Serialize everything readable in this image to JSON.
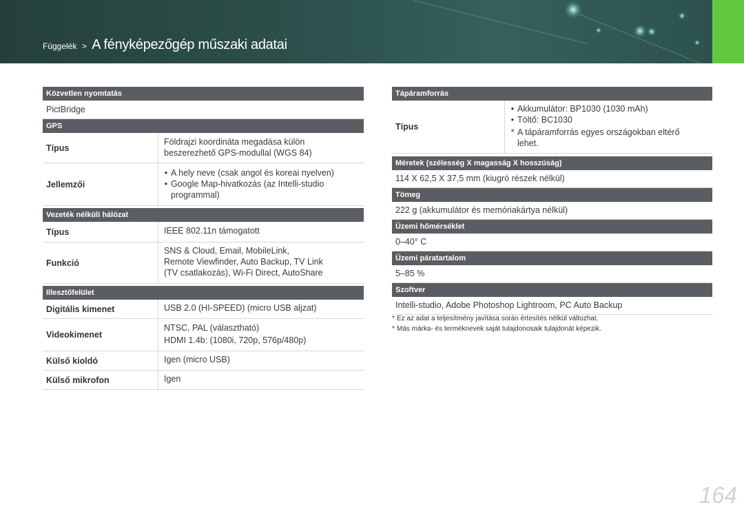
{
  "header": {
    "breadcrumb_prefix": "Függelék",
    "breadcrumb_sep": ">",
    "title": "A fényképezőgép műszaki adatai"
  },
  "left": {
    "direct_print": {
      "title": "Közvetlen nyomtatás",
      "value": "PictBridge"
    },
    "gps": {
      "title": "GPS",
      "type_label": "Típus",
      "type_value": [
        "Földrajzi koordináta megadása külön",
        "beszerezhető GPS-modullal (WGS 84)"
      ],
      "features_label": "Jellemzői",
      "features": [
        [
          "A hely neve (csak angol és koreai nyelven)"
        ],
        [
          "Google Map-hivatkozás (az Intelli-studio",
          "programmal)"
        ]
      ]
    },
    "wireless": {
      "title": "Vezeték nélküli hálózat",
      "type_label": "Típus",
      "type_value": "IEEE 802.11n támogatott",
      "function_label": "Funkció",
      "function_value": [
        "SNS & Cloud, Email, MobileLink,",
        "Remote Viewfinder, Auto Backup, TV Link",
        "(TV csatlakozás), Wi-Fi Direct, AutoShare"
      ]
    },
    "interface": {
      "title": "Illesztőfelület",
      "rows": [
        {
          "label": "Digitális kimenet",
          "value": [
            "USB 2.0 (HI-SPEED) (micro USB aljzat)"
          ]
        },
        {
          "label": "Videokimenet",
          "value": [
            "NTSC, PAL (választható)",
            "HDMI 1.4b: (1080i, 720p, 576p/480p)"
          ]
        },
        {
          "label": "Külső kioldó",
          "value": [
            "Igen (micro USB)"
          ]
        },
        {
          "label": "Külső mikrofon",
          "value": [
            "Igen"
          ]
        }
      ]
    }
  },
  "right": {
    "power": {
      "title": "Tápáramforrás",
      "type_label": "Típus",
      "items": [
        {
          "marker": "•",
          "lines": [
            "Akkumulátor: BP1030 (1030 mAh)"
          ]
        },
        {
          "marker": "•",
          "lines": [
            "Töltő: BC1030"
          ]
        },
        {
          "marker": "*",
          "lines": [
            "A tápáramforrás egyes országokban eltérő",
            "lehet."
          ]
        }
      ]
    },
    "dimensions": {
      "title": "Méretek (szélesség X magasság X hosszúság)",
      "value": "114 X 62,5 X 37,5 mm (kiugró részek nélkül)"
    },
    "weight": {
      "title": "Tömeg",
      "value": "222 g (akkumulátor és memóriakártya nélkül)"
    },
    "op_temp": {
      "title": "Üzemi hőmérséklet",
      "value": "0–40° C"
    },
    "op_humidity": {
      "title": "Üzemi páratartalom",
      "value": "5–85 %"
    },
    "software": {
      "title": "Szoftver",
      "value": "Intelli-studio, Adobe Photoshop Lightroom, PC Auto Backup"
    },
    "footnotes": [
      "Ez az adat a teljesítmény javítása során értesítés nélkül változhat.",
      "Más márka- és terméknevek saját tulajdonosaik tulajdonát képezik."
    ],
    "footnote_marker": "*"
  },
  "page_number": "164",
  "colors": {
    "header": "#2c4f4a",
    "accent_tab": "#62c93f",
    "section_header": "#5a5d61"
  }
}
